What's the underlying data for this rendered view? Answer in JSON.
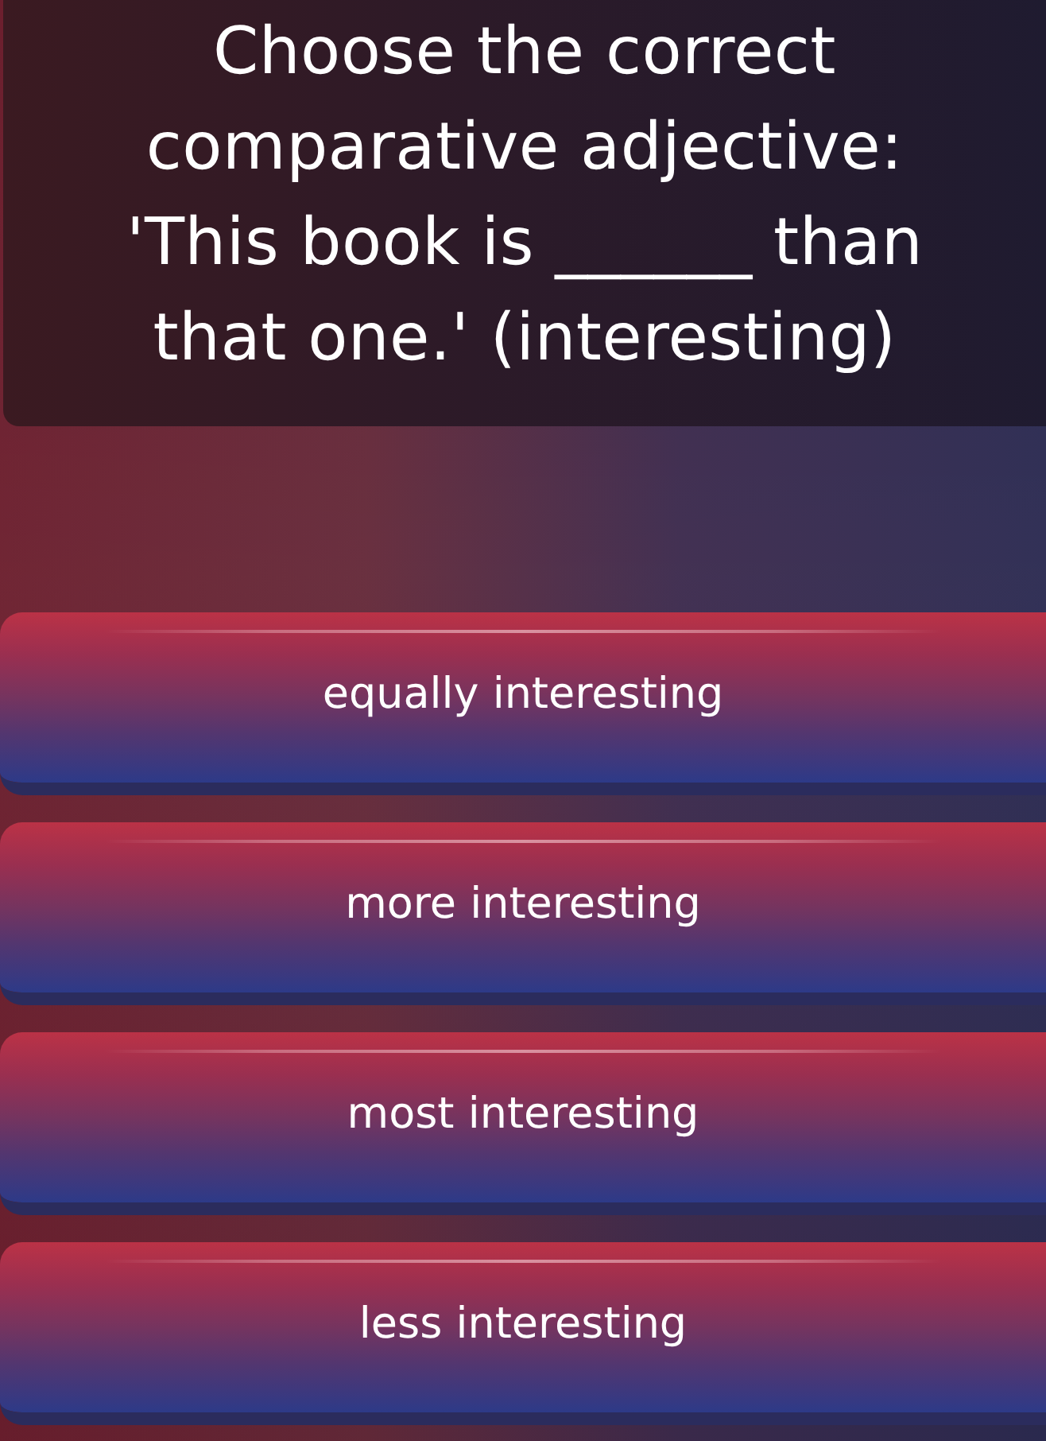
{
  "question": {
    "text": "Choose the correct comparative adjective: 'This book is ______ than that one.' (interesting)"
  },
  "options": [
    {
      "label": "equally interesting"
    },
    {
      "label": "more interesting"
    },
    {
      "label": "most interesting"
    },
    {
      "label": "less interesting"
    }
  ]
}
